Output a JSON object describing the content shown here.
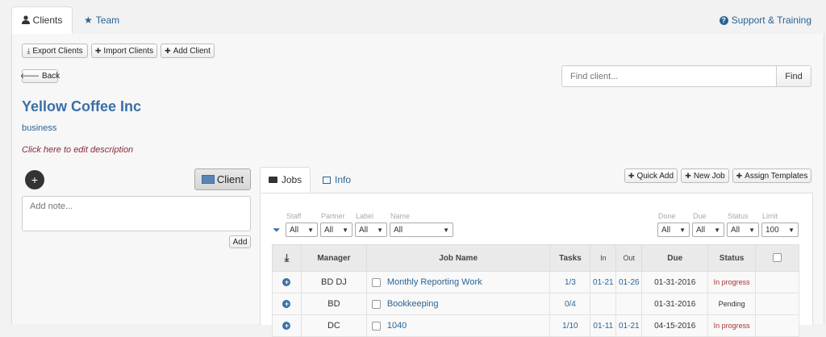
{
  "nav": {
    "tabs": [
      {
        "label": "Clients",
        "icon": "user-icon"
      },
      {
        "label": "Team",
        "icon": "star-icon"
      }
    ],
    "support": "Support & Training"
  },
  "toolbar": {
    "export": "Export Clients",
    "import": "Import Clients",
    "add": "Add Client",
    "back": "Back"
  },
  "search": {
    "placeholder": "Find client...",
    "button": "Find"
  },
  "client": {
    "name": "Yellow Coffee Inc",
    "type": "business",
    "edit_description": "Click here to edit description",
    "client_button": "Client"
  },
  "notes": {
    "placeholder": "Add note...",
    "add_button": "Add"
  },
  "subtabs": {
    "jobs": "Jobs",
    "info": "Info"
  },
  "actions": {
    "quick_add": "Quick Add",
    "new_job": "New Job",
    "assign_templates": "Assign Templates"
  },
  "filters": {
    "staff": {
      "label": "Staff",
      "value": "All"
    },
    "partner": {
      "label": "Partner",
      "value": "All"
    },
    "label": {
      "label": "Label",
      "value": "All"
    },
    "name": {
      "label": "Name",
      "value": "All"
    },
    "done": {
      "label": "Done",
      "value": "All"
    },
    "due": {
      "label": "Due",
      "value": "All"
    },
    "status": {
      "label": "Status",
      "value": "All"
    },
    "limit": {
      "label": "Limit",
      "value": "100"
    }
  },
  "table": {
    "headers": {
      "manager": "Manager",
      "job_name": "Job Name",
      "tasks": "Tasks",
      "in": "In",
      "out": "Out",
      "due": "Due",
      "status": "Status"
    },
    "rows": [
      {
        "manager": "BD DJ",
        "job": "Monthly Reporting Work",
        "tasks": "1/3",
        "in": "01-21",
        "out": "01-26",
        "due": "01-31-2016",
        "status": "In progress"
      },
      {
        "manager": "BD",
        "job": "Bookkeeping",
        "tasks": "0/4",
        "in": "",
        "out": "",
        "due": "01-31-2016",
        "status": "Pending"
      },
      {
        "manager": "DC",
        "job": "1040",
        "tasks": "1/10",
        "in": "01-11",
        "out": "01-21",
        "due": "04-15-2016",
        "status": "In progress"
      }
    ]
  },
  "colors": {
    "accent": "#3a6fa8",
    "status_red": "#aa3333",
    "description": "#8a2a3a"
  }
}
